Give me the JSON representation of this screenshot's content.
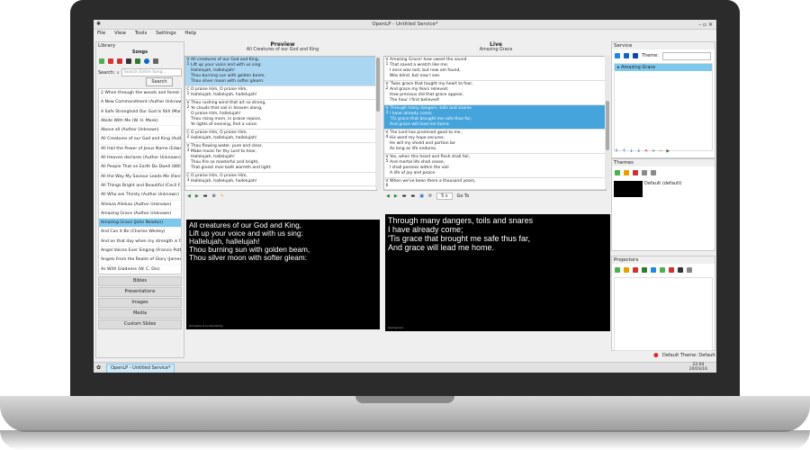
{
  "window": {
    "title": "OpenLP - Untitled Service*",
    "app_icon": "openlp-icon",
    "controls": "–  ▫  ✕"
  },
  "menu": [
    "File",
    "View",
    "Tools",
    "Settings",
    "Help"
  ],
  "library": {
    "title": "Library",
    "section": "Songs",
    "search_label": "Search:",
    "search_placeholder": "Search Entire Song...",
    "search_button": "Search",
    "songs": [
      "2 When through the woods and forest glad...",
      "A New Commandment (Author Unknown)",
      "A Safe Stronghold Our God Is Still (Martin...",
      "Abide With Me (W. H. Monk)",
      "Above all (Author Unknown)",
      "All Creatures of our God and King (Author...",
      "All Hail the Power of Jesus Name (Edward...",
      "All Heaven declares (Author Unknown)",
      "All People That on Earth Do Dwell (William...",
      "All the Way My Saviour Leads Me (Fanny...",
      "All Things Bright and Beautiful (Cecil F. Al...",
      "All Who are Thirsty (Author Unknown)",
      "Alleluia Alleluia (Author Unknown)",
      "Amazing Grace (Author Unknown)",
      "Amazing Grace (John Newton)",
      "And Can it Be (Charles Wesley)",
      "And on that day when my strength is fail...",
      "Angel Voices Ever Singing (Francis Pott)",
      "Angels From the Realm of Glory (James M...",
      "As With Gladness (W. C. Dix)",
      "At the Name of Jesus (Caroline Maria Noel)",
      "Away in a Manger (Author Unknown)"
    ],
    "selected_index": 14,
    "categories": [
      "Bibles",
      "Presentations",
      "Images",
      "Media",
      "Custom Slides"
    ]
  },
  "preview": {
    "title": "Preview",
    "subtitle": "All Creatures of our God and King",
    "verses": [
      {
        "tag": "V\n1",
        "lines": [
          "All creatures of our God and King,",
          "Lift up your voice and with us sing:",
          "Hallelujah, hallelujah!",
          "Thou burning sun with golden beam,",
          "Thou silver moon with softer gleam:"
        ],
        "selected": true
      },
      {
        "tag": "C\n1",
        "lines": [
          "O praise Him, O praise Him,",
          "Hallelujah, hallelujah, hallelujah!"
        ],
        "selected": false
      },
      {
        "tag": "V\n2",
        "lines": [
          "Thou rushing wind that art so strong,",
          "Ye clouds that sail in heaven along,",
          "O praise Him, hallelujah!",
          "Thou rising morn, in praise rejoice,",
          "Ye lights of evening, find a voice:"
        ],
        "selected": false
      },
      {
        "tag": "C\n2",
        "lines": [
          "O praise Him, O praise Him,",
          "Hallelujah, hallelujah, hallelujah!"
        ],
        "selected": false
      },
      {
        "tag": "V\n3",
        "lines": [
          "Thou flowing water, pure and clear,",
          "Make music for thy Lord to hear,",
          "Hallelujah, hallelujah!",
          "Thou fire so masterful and bright,",
          "That givest man both warmth and light:"
        ],
        "selected": false
      },
      {
        "tag": "C\n3",
        "lines": [
          "O praise Him, O praise Him,",
          "Hallelujah, hallelujah, hallelujah!"
        ],
        "selected": false
      }
    ],
    "display_lines": [
      "All creatures of our God and King,",
      "Lift up your voice and with us sing:",
      "Hallelujah, hallelujah!",
      "Thou burning sun with golden beam,",
      "Thou silver moon with softer gleam:"
    ],
    "footer": "All Creatures of our God and King"
  },
  "live": {
    "title": "Live",
    "subtitle": "Amazing Grace",
    "verses": [
      {
        "tag": "V\n1",
        "lines": [
          "Amazing Grace! how sweet the sound",
          "That saved a wretch like me;",
          "I once was lost, but now am found,",
          "Was blind, but now I see."
        ],
        "selected": false
      },
      {
        "tag": "V\n2",
        "lines": [
          "'Twas grace that taught my heart to fear,",
          "And grace my fears relieved;",
          "How precious did that grace appear,",
          "The hour I first believed!"
        ],
        "selected": false
      },
      {
        "tag": "V\n3",
        "lines": [
          "Through many dangers, toils and snares",
          "I have already come;",
          "'Tis grace that brought me safe thus far,",
          "And grace will lead me home."
        ],
        "selected": true
      },
      {
        "tag": "V\n4",
        "lines": [
          "The Lord has promised good to me,",
          "His word my hope secures;",
          "He will my shield and portion be",
          "As long as life endures."
        ],
        "selected": false
      },
      {
        "tag": "V\n5",
        "lines": [
          "Yes, when this heart and flesh shall fail,",
          "And mortal life shall cease,",
          "I shall possess within the veil",
          "A life of joy and peace."
        ],
        "selected": false
      },
      {
        "tag": "V\n6",
        "lines": [
          "When we've been there a thousand years,"
        ],
        "selected": false
      }
    ],
    "display_lines": [
      "Through many dangers, toils and snares",
      "I have already come;",
      "'Tis grace that brought me safe thus far,",
      "And grace will lead me home."
    ],
    "footer": "Amazing Grace",
    "timer": "5 s",
    "goto": "Go To"
  },
  "service": {
    "title": "Service",
    "theme_label": "Theme:",
    "items": [
      "Amazing Grace"
    ]
  },
  "themes": {
    "title": "Themes",
    "items": [
      "Default (default)"
    ]
  },
  "projectors": {
    "title": "Projectors"
  },
  "status": {
    "theme": "Default Theme: Default"
  },
  "taskbar": {
    "window_label": "OpenLP - Untitled Service*",
    "time": "22:04",
    "date": "20/03/16"
  }
}
